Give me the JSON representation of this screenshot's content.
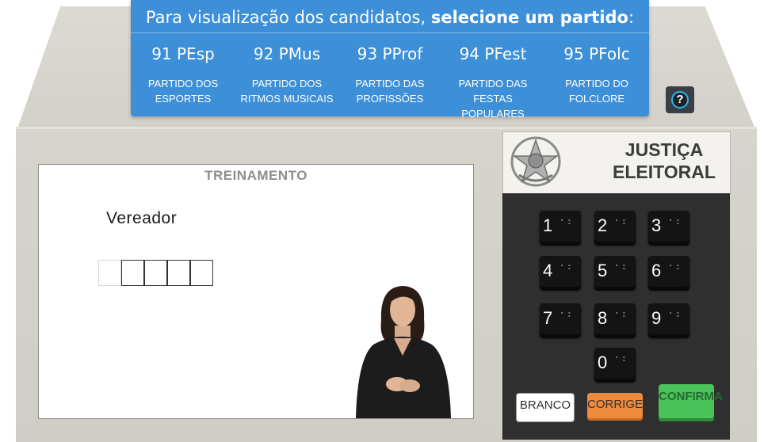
{
  "banner": {
    "title_prefix": "Para visualização dos candidatos, ",
    "title_emphasis": "selecione um partido",
    "title_suffix": ":",
    "parties": [
      {
        "code": "91 PEsp",
        "name_line1": "PARTIDO DOS",
        "name_line2": "ESPORTES"
      },
      {
        "code": "92 PMus",
        "name_line1": "PARTIDO DOS",
        "name_line2": "RITMOS MUSICAIS"
      },
      {
        "code": "93 PProf",
        "name_line1": "PARTIDO DAS",
        "name_line2": "PROFISSÕES"
      },
      {
        "code": "94 PFest",
        "name_line1": "PARTIDO DAS",
        "name_line2": "FESTAS POPULARES"
      },
      {
        "code": "95 PFolc",
        "name_line1": "PARTIDO DO",
        "name_line2": "FOLCLORE"
      }
    ],
    "help_label": "?"
  },
  "screen": {
    "label": "TREINAMENTO",
    "office": "Vereador",
    "digit_count": 5
  },
  "panel": {
    "title_line1": "JUSTIÇA",
    "title_line2": "ELEITORAL",
    "keys": [
      "1",
      "2",
      "3",
      "4",
      "5",
      "6",
      "7",
      "8",
      "9",
      "0"
    ],
    "braille": "⠁⠃",
    "branco": "BRANCO",
    "corrige": "CORRIGE",
    "confirma": "CONFIRMA"
  },
  "icons": {
    "help": "help-icon",
    "emblem": "coat-of-arms-icon"
  },
  "colors": {
    "banner": "#3d8fd8",
    "help_ring": "#2fb4e8",
    "corrige": "#f08a3c",
    "confirma": "#49c25a"
  }
}
